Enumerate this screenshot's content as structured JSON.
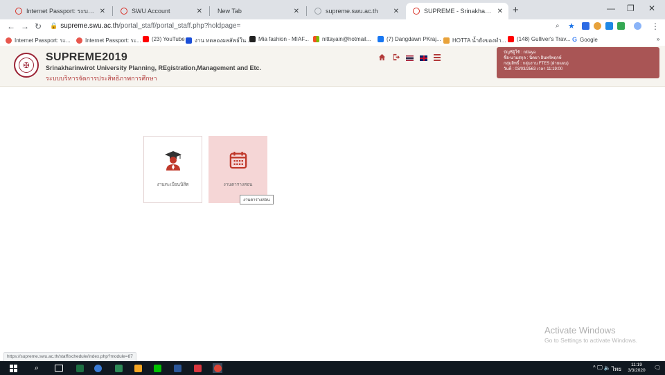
{
  "browser": {
    "tabs": [
      {
        "title": "Internet Passport: ระบบยืนยันตัวตนฯ",
        "active": false
      },
      {
        "title": "SWU Account",
        "active": false
      },
      {
        "title": "New Tab",
        "active": false
      },
      {
        "title": "supreme.swu.ac.th",
        "active": false
      },
      {
        "title": "SUPREME - Srinakharinwirot Uni",
        "active": true
      }
    ],
    "url_host": "supreme.swu.ac.th",
    "url_path": "/portal_staff/portal_staff.php?holdpage=",
    "bookmarks": [
      {
        "label": "Internet Passport: ระ...",
        "color": "#e8574d"
      },
      {
        "label": "Internet Passport: ระ...",
        "color": "#e8574d"
      },
      {
        "label": "(23) YouTube",
        "color": "#ff0000"
      },
      {
        "label": "งาน ทดลองผลลัพธ์ใน...",
        "color": "#1a4ed8"
      },
      {
        "label": "Mia fashion - MIAF...",
        "color": "#222222"
      },
      {
        "label": "nittayain@hotmail...",
        "color": "#f25022"
      },
      {
        "label": "(7) Dangdawn PKraj...",
        "color": "#1877f2"
      },
      {
        "label": "HOTTA น้ำยังของทำ...",
        "color": "#e8a23a"
      },
      {
        "label": "(148) Gulliver's Trav...",
        "color": "#ff0000"
      },
      {
        "label": "Google",
        "color": "#4285f4"
      }
    ],
    "status_url": "https://supreme.swu.ac.th/staff/schedule/index.php?module=87"
  },
  "site": {
    "title": "SUPREME2019",
    "subtitle": "Srinakharinwirot University Planning, REgistration,Management and Etc.",
    "thai_subtitle": "ระบบบริหารจัดการประสิทธิภาพการศึกษา",
    "user_info": [
      "บัญชีผู้ใช้ : nittaya",
      "ชื่อ-นามสกุล : นิตยา อินทร์พฤกษ์",
      "กลุ่มสิทธิ์ : กลุ่มงาน FTES (ฝ่ายแผน)",
      "วันที่ : 03/03/2563 เวลา 11:19:00"
    ],
    "colors": {
      "accent": "#a95555",
      "brand": "#9b2335"
    }
  },
  "cards": [
    {
      "label": "งานทะเบียนนิสิต",
      "icon": "graduate-icon"
    },
    {
      "label": "งานตารางสอน",
      "icon": "calendar-icon"
    }
  ],
  "tooltip": "งานตารางสอน",
  "watermark": {
    "title": "Activate Windows",
    "subtitle": "Go to Settings to activate Windows."
  },
  "taskbar": {
    "language": "ไทย",
    "time": "11:19",
    "date": "3/3/2020"
  }
}
